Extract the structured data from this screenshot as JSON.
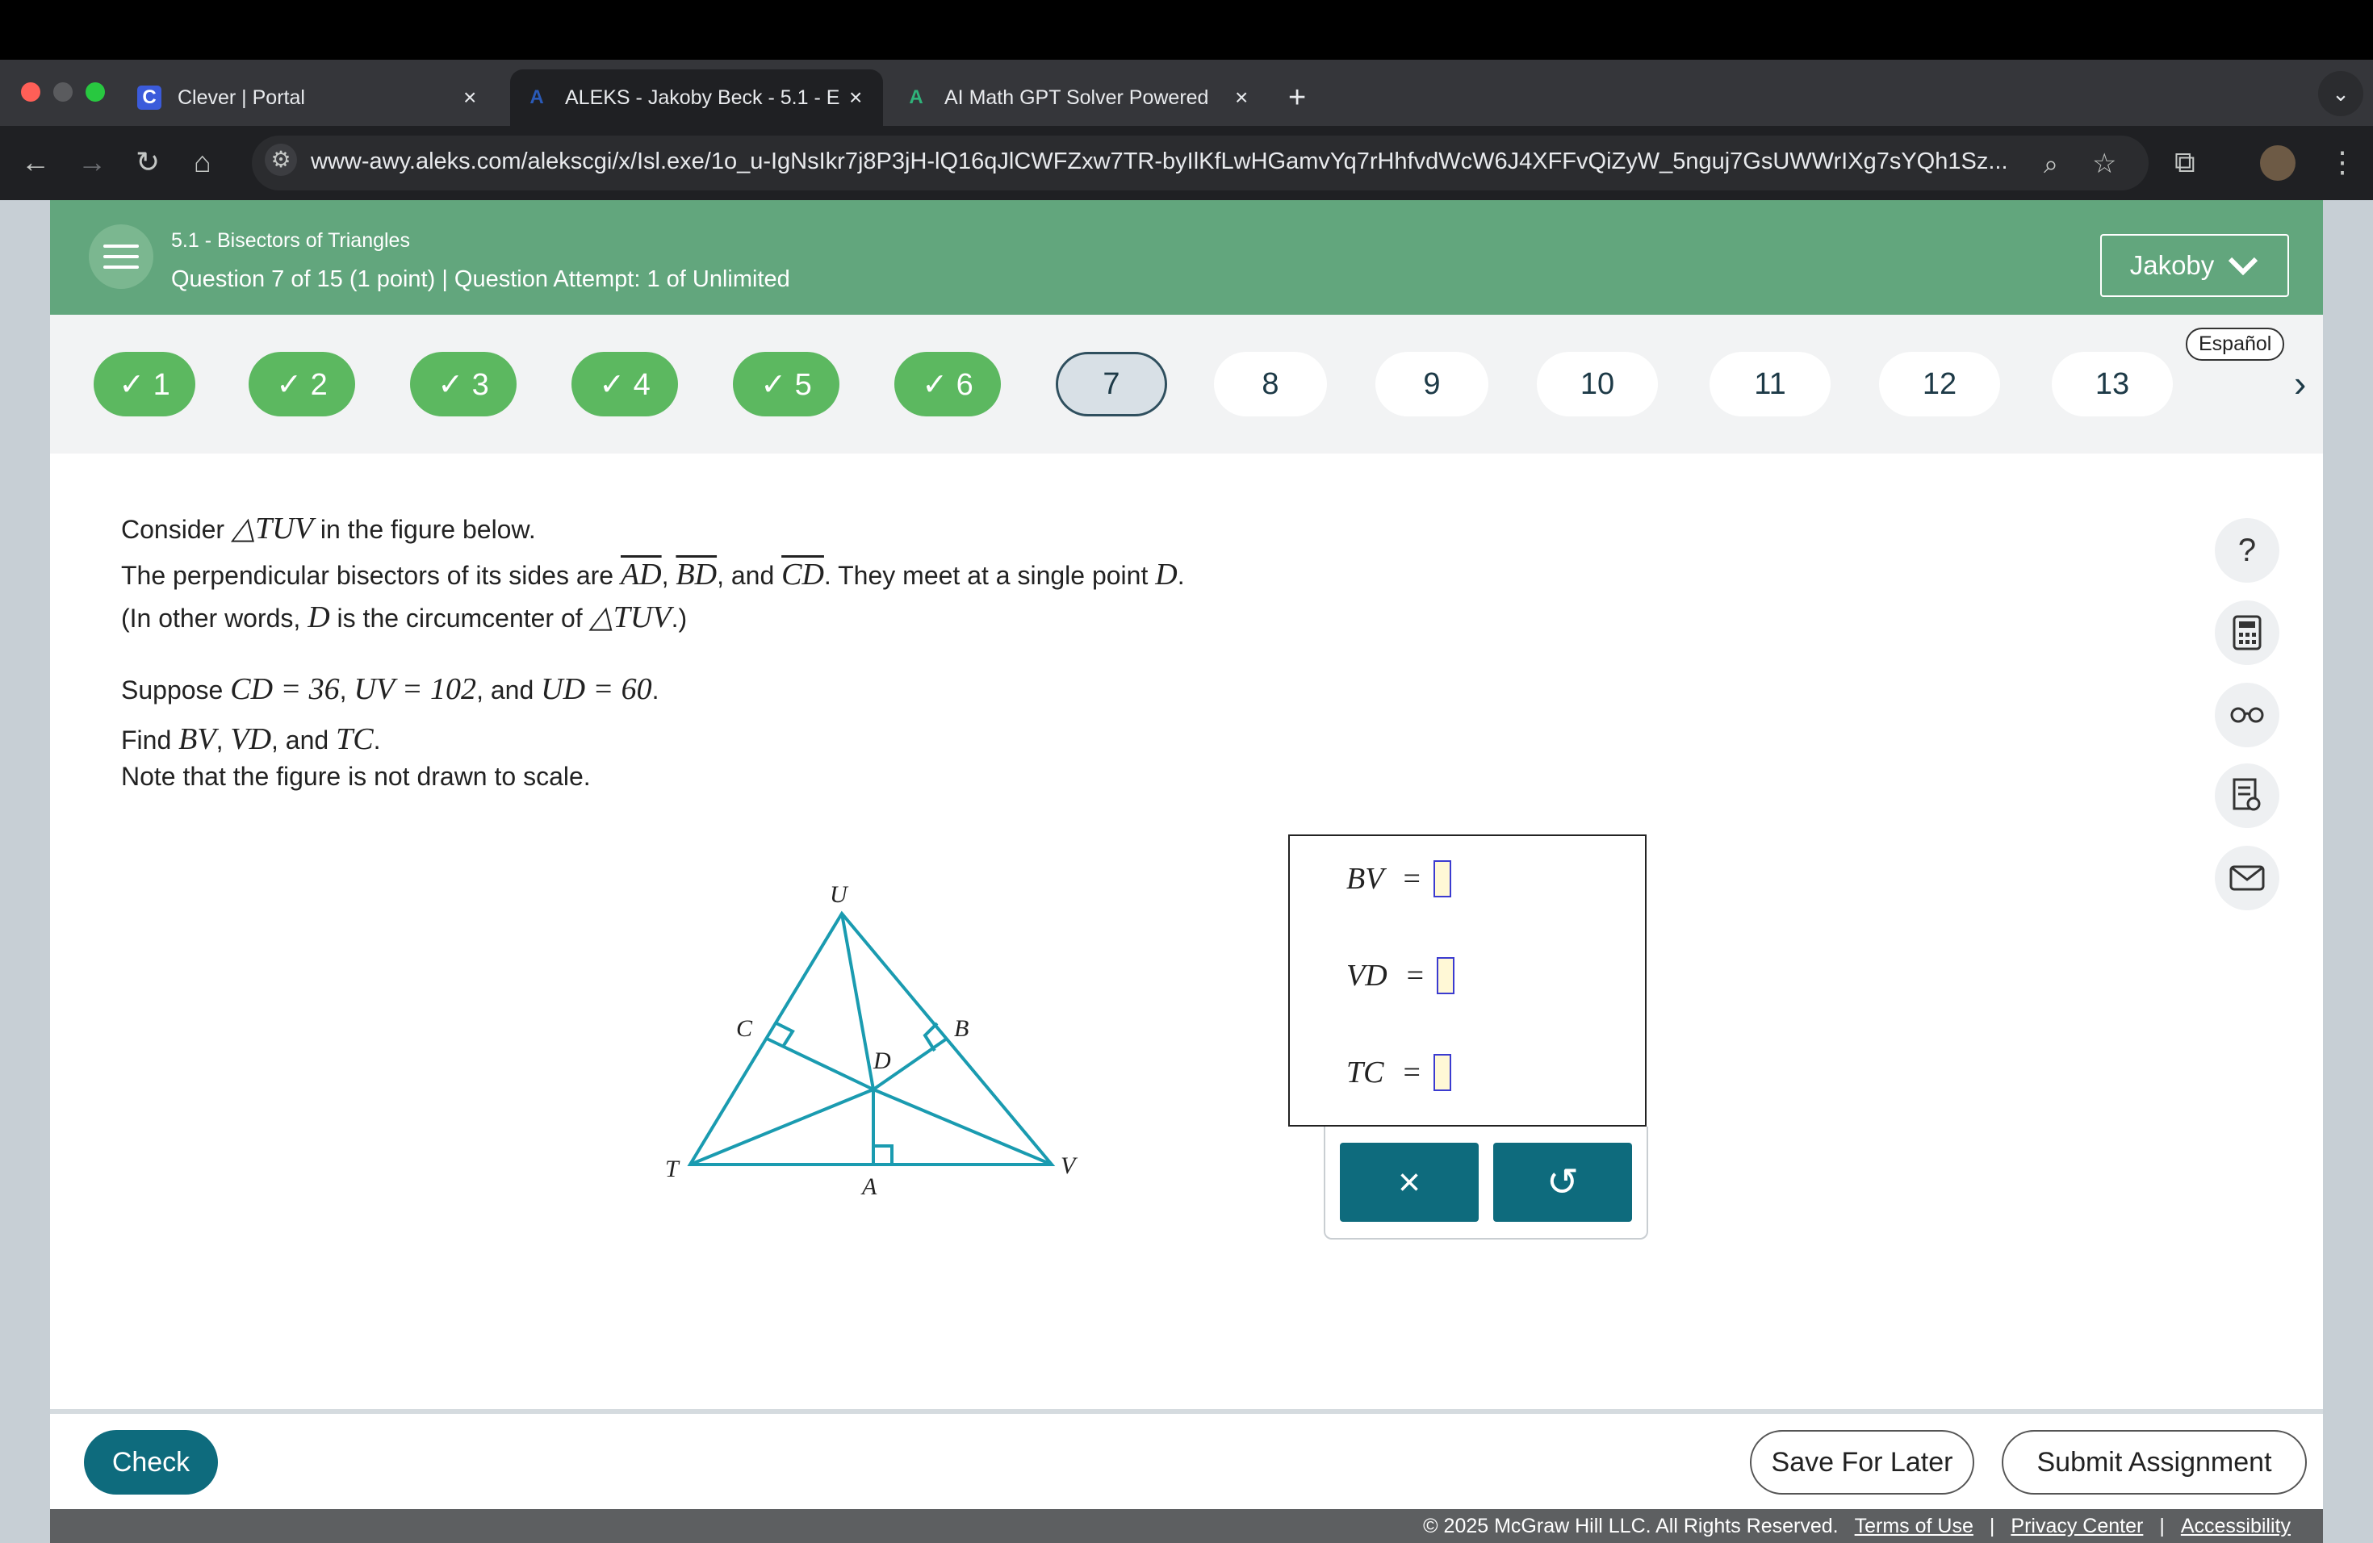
{
  "browser": {
    "tabs": [
      {
        "title": "Clever | Portal",
        "favicon": "C"
      },
      {
        "title": "ALEKS - Jakoby Beck - 5.1 - E",
        "favicon": "A"
      },
      {
        "title": "AI Math GPT Solver Powered",
        "favicon": "A"
      }
    ],
    "url": "www-awy.aleks.com/alekscgi/x/Isl.exe/1o_u-IgNsIkr7j8P3jH-lQ16qJlCWFZxw7TR-byIlKfLwHGamvYq7rHhfvdWcW6J4XFFvQiZyW_5nguj7GsUWWrIXg7sYQh1Sz..."
  },
  "header": {
    "topic": "5.1 - Bisectors of Triangles",
    "question_info": "Question 7 of 15 (1 point)  |  Question Attempt: 1 of Unlimited",
    "user": "Jakoby"
  },
  "nav": {
    "espanol": "Español",
    "questions": [
      "1",
      "2",
      "3",
      "4",
      "5",
      "6",
      "7",
      "8",
      "9",
      "10",
      "11",
      "12",
      "13"
    ],
    "done": [
      true,
      true,
      true,
      true,
      true,
      true,
      false,
      false,
      false,
      false,
      false,
      false,
      false
    ],
    "current": "7"
  },
  "question": {
    "l1a": "Consider ",
    "l1m": "△TUV",
    "l1b": " in the figure below.",
    "l2a": "The perpendicular bisectors of its sides are ",
    "s1": "AD",
    "c1": ", ",
    "s2": "BD",
    "c2": ", and ",
    "s3": "CD",
    "l2b": ". They meet at a single point ",
    "l2m": "D",
    "l2c": ".",
    "l3a": "(In other words, ",
    "l3m": "D",
    "l3b": " is the circumcenter of ",
    "l3m2": "△TUV",
    "l3c": ".)",
    "l4a": "Suppose  ",
    "l4m1": "CD = 36",
    "l4c1": ",  ",
    "l4m2": "UV = 102",
    "l4c2": ", and  ",
    "l4m3": "UD = 60",
    "l4c3": ".",
    "l5a": "Find  ",
    "l5m1": "BV",
    "l5c1": ",  ",
    "l5m2": "VD",
    "l5c2": ", and  ",
    "l5m3": "TC",
    "l5c3": ".",
    "l6": "Note that the figure is not drawn to scale."
  },
  "figure": {
    "labels": {
      "U": "U",
      "C": "C",
      "B": "B",
      "D": "D",
      "T": "T",
      "A": "A",
      "V": "V"
    },
    "line_color": "#1a9bb0"
  },
  "answers": [
    {
      "label": "BV",
      "eq": "="
    },
    {
      "label": "VD",
      "eq": "="
    },
    {
      "label": "TC",
      "eq": "="
    }
  ],
  "keypad": {
    "clear": "×",
    "undo": "↺"
  },
  "footer": {
    "check": "Check",
    "save": "Save For Later",
    "submit": "Submit Assignment",
    "copyright": "© 2025 McGraw Hill LLC. All Rights Reserved.",
    "terms": "Terms of Use",
    "privacy": "Privacy Center",
    "accessibility": "Accessibility"
  },
  "tools": [
    "help-icon",
    "calculator-icon",
    "glasses-icon",
    "notes-icon",
    "mail-icon"
  ],
  "help_glyph": "?"
}
